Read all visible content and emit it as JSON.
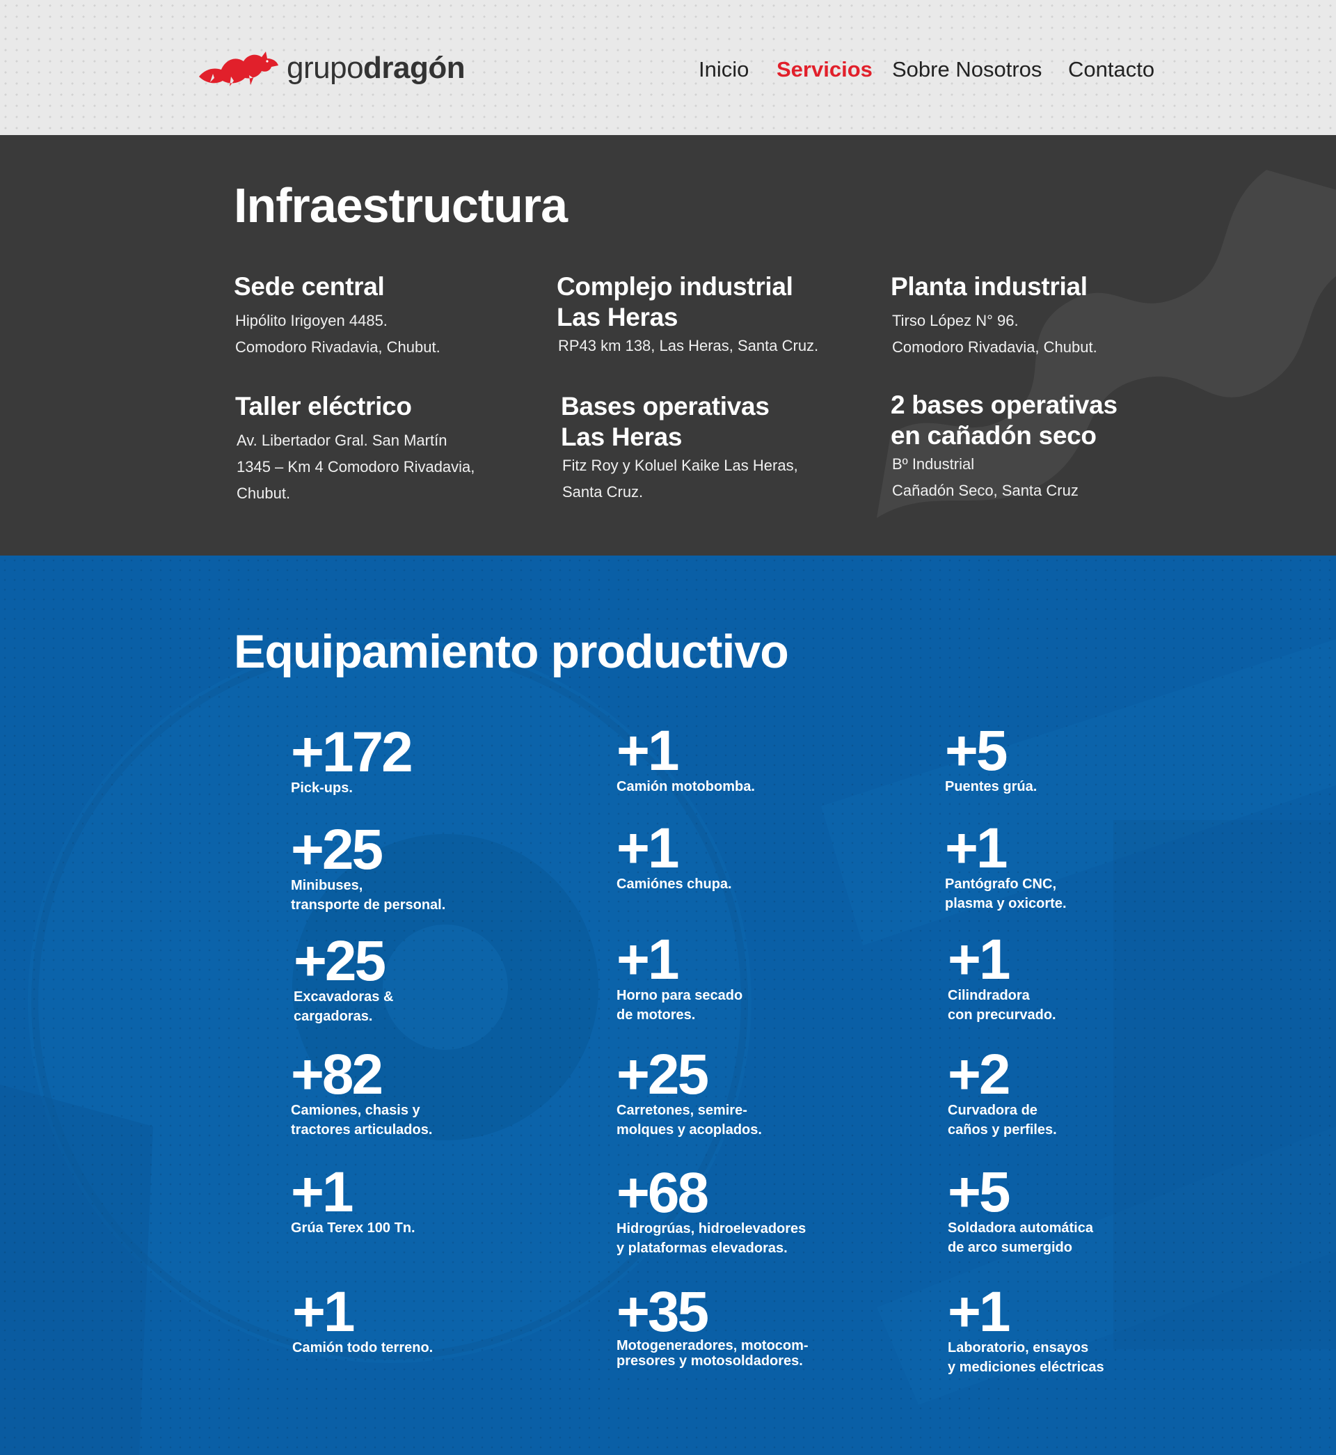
{
  "header": {
    "logo": {
      "text_light": "grupo",
      "text_bold": "dragón",
      "icon": "dragon-icon"
    },
    "nav": [
      {
        "label": "Inicio",
        "active": false
      },
      {
        "label": "Servicios",
        "active": true
      },
      {
        "label": "Sobre Nosotros",
        "active": false
      },
      {
        "label": "Contacto",
        "active": false
      }
    ],
    "active_color": "#e1202b"
  },
  "infra": {
    "title": "Infraestructura",
    "locations": [
      {
        "title": "Sede central",
        "address": "Hipólito Irigoyen 4485.\nComodoro Rivadavia, Chubut."
      },
      {
        "title": "Complejo industrial\nLas Heras",
        "address": "RP43 km 138, Las Heras, Santa Cruz."
      },
      {
        "title": "Planta industrial",
        "address": "Tirso López N° 96.\nComodoro Rivadavia, Chubut."
      },
      {
        "title": "Taller eléctrico",
        "address": "Av. Libertador Gral. San Martín\n1345 – Km 4 Comodoro Rivadavia,\nChubut."
      },
      {
        "title": "Bases operativas\nLas Heras",
        "address": "Fitz Roy y Koluel Kaike Las Heras,\nSanta Cruz."
      },
      {
        "title": "2 bases operativas\nen cañadón seco",
        "address": "Bº Industrial\nCañadón Seco, Santa Cruz"
      }
    ],
    "background": "#3a3a3a"
  },
  "equip": {
    "title": "Equipamiento productivo",
    "background": "#0a5fa6",
    "stats": [
      {
        "num": "+172",
        "label": "Pick-ups."
      },
      {
        "num": "+1",
        "label": "Camión motobomba."
      },
      {
        "num": "+5",
        "label": "Puentes grúa."
      },
      {
        "num": "+25",
        "label": "Minibuses,\ntransporte de personal."
      },
      {
        "num": "+1",
        "label": "Camiónes chupa."
      },
      {
        "num": "+1",
        "label": "Pantógrafo CNC,\nplasma y oxicorte."
      },
      {
        "num": "+25",
        "label": "Excavadoras &\ncargadoras."
      },
      {
        "num": "+1",
        "label": "Horno para secado\nde motores."
      },
      {
        "num": "+1",
        "label": "Cilindradora\ncon precurvado."
      },
      {
        "num": "+82",
        "label": "Camiones, chasis y\ntractores articulados."
      },
      {
        "num": "+25",
        "label": "Carretones, semire-\nmolques y acoplados."
      },
      {
        "num": "+2",
        "label": "Curvadora de\ncaños y perfiles."
      },
      {
        "num": "+1",
        "label": "Grúa Terex 100 Tn."
      },
      {
        "num": "+68",
        "label": "Hidrogrúas, hidroelevadores\ny plataformas elevadoras."
      },
      {
        "num": "+5",
        "label": "Soldadora automática\nde arco sumergido"
      },
      {
        "num": "+1",
        "label": "Camión todo terreno."
      },
      {
        "num": "+35",
        "label": "Motogeneradores,  motocom-\npresores y motosoldadores."
      },
      {
        "num": "+1",
        "label": "Laboratorio, ensayos\ny mediciones eléctricas"
      }
    ]
  }
}
